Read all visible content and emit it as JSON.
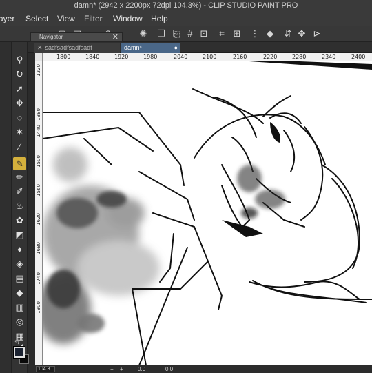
{
  "window": {
    "title": "damn* (2942 x 2200px 72dpi 104.3%)  - CLIP STUDIO PAINT PRO"
  },
  "menu": {
    "items": [
      "ayer",
      "Select",
      "View",
      "Filter",
      "Window",
      "Help"
    ]
  },
  "navigator": {
    "title": "Navigator",
    "close": "✕"
  },
  "tabs": [
    {
      "label": "sadfsadfsadfsadf",
      "close": "✕"
    },
    {
      "label": "damn*",
      "dot": "●"
    }
  ],
  "ruler": {
    "top_labels": [
      "1800",
      "1840",
      "1920",
      "1980",
      "2040",
      "2100",
      "2160",
      "2220",
      "2280",
      "2340",
      "2400"
    ],
    "left_labels": [
      "1320",
      "1380",
      "1440",
      "1500",
      "1560",
      "1620",
      "1680",
      "1740",
      "1800"
    ]
  },
  "status": {
    "zoom": "104.3",
    "angle": "0.0",
    "extra": "0.0"
  },
  "colors": {
    "main": "#1b2231",
    "sub": "#0a0a0a",
    "accent": "#d4b03c",
    "tab_active": "#4a6788"
  },
  "toolbox": {
    "icons": [
      "zoom-icon",
      "rotate-icon",
      "operation-icon",
      "move-icon",
      "lasso-icon",
      "magic-wand-icon",
      "eyedropper-icon",
      "pen-icon",
      "pencil-icon",
      "brush-icon",
      "airbrush-icon",
      "decoration-icon",
      "eraser-icon",
      "blend-icon",
      "figure-icon",
      "frame-icon",
      "fill-icon",
      "gradient-icon",
      "text-icon",
      "balloon-icon",
      "ruler-icon"
    ]
  }
}
